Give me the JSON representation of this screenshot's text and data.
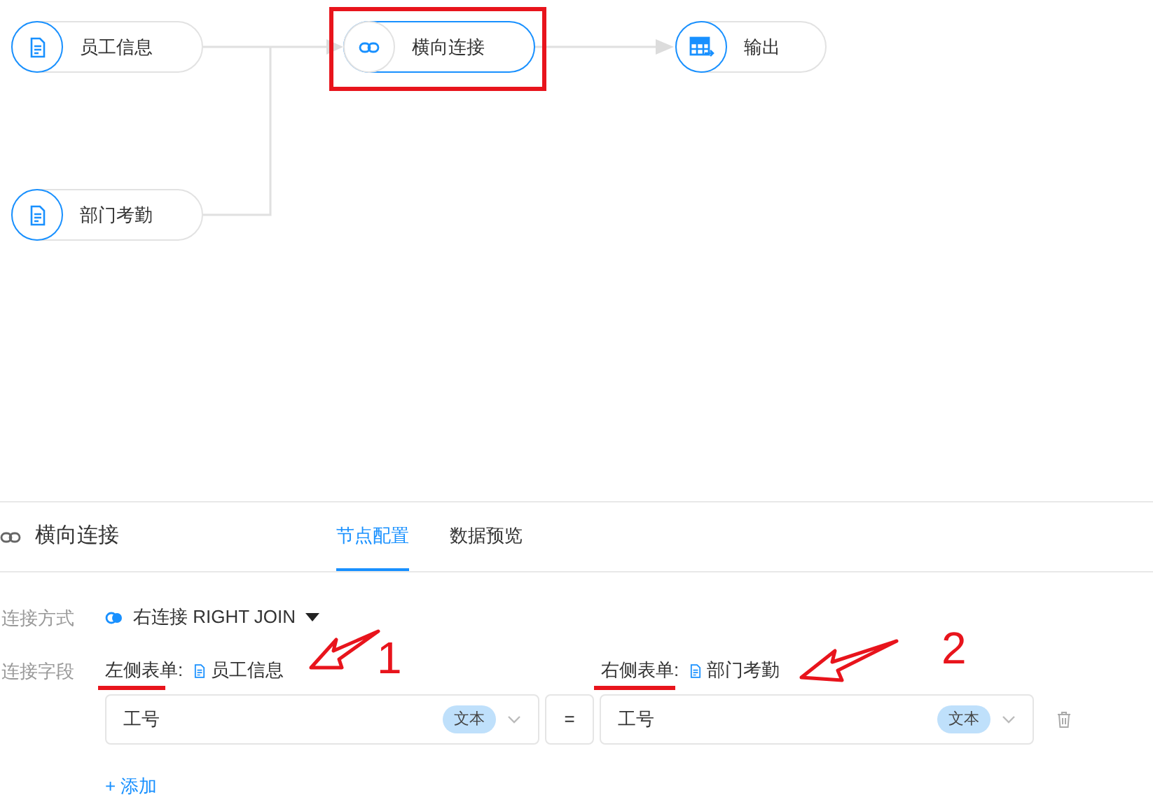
{
  "canvas": {
    "nodes": [
      {
        "label": "员工信息",
        "kind": "source",
        "selected": false
      },
      {
        "label": "横向连接",
        "kind": "join",
        "selected": true
      },
      {
        "label": "输出",
        "kind": "output",
        "selected": false
      },
      {
        "label": "部门考勤",
        "kind": "source",
        "selected": false
      }
    ]
  },
  "panel": {
    "title": "横向连接",
    "tabs": [
      {
        "label": "节点配置",
        "selected": true
      },
      {
        "label": "数据预览",
        "selected": false
      }
    ],
    "join_type": {
      "label": "连接方式",
      "value": "右连接 RIGHT JOIN"
    },
    "join_fields": {
      "label": "连接字段",
      "left": {
        "label": "左侧表单:",
        "table": "员工信息",
        "field": "工号",
        "type": "文本"
      },
      "operator": "=",
      "right": {
        "label": "右侧表单:",
        "table": "部门考勤",
        "field": "工号",
        "type": "文本"
      }
    },
    "add": "+ 添加"
  },
  "annotations": [
    {
      "label": "1"
    },
    {
      "label": "2"
    }
  ]
}
